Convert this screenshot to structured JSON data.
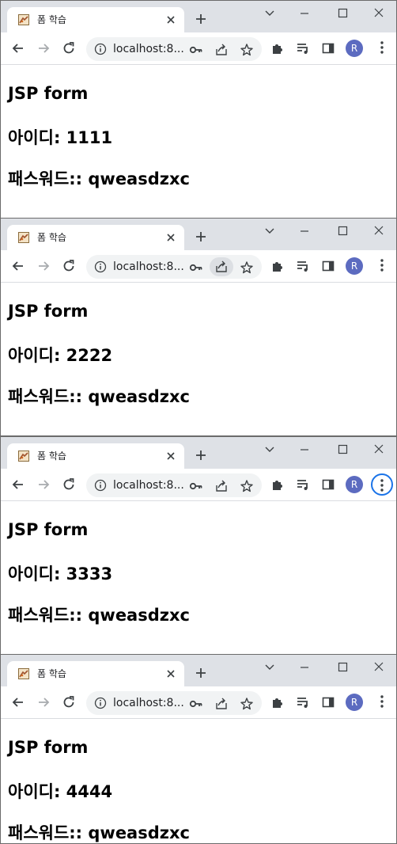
{
  "windows": [
    {
      "tab_title": "폼 학습",
      "url": "localhost:8...",
      "avatar_letter": "R",
      "heading": "JSP form",
      "id_line": "아이디: 1111",
      "pw_line": "패스워드:: qweasdzxc",
      "share_highlighted": false,
      "menu_focused": false
    },
    {
      "tab_title": "폼 학습",
      "url": "localhost:8...",
      "avatar_letter": "R",
      "heading": "JSP form",
      "id_line": "아이디: 2222",
      "pw_line": "패스워드:: qweasdzxc",
      "share_highlighted": true,
      "menu_focused": false
    },
    {
      "tab_title": "폼 학습",
      "url": "localhost:8...",
      "avatar_letter": "R",
      "heading": "JSP form",
      "id_line": "아이디: 3333",
      "pw_line": "패스워드:: qweasdzxc",
      "share_highlighted": false,
      "menu_focused": true
    },
    {
      "tab_title": "폼 학습",
      "url": "localhost:8...",
      "avatar_letter": "R",
      "heading": "JSP form",
      "id_line": "아이디: 4444",
      "pw_line": "패스워드:: qweasdzxc",
      "share_highlighted": false,
      "menu_focused": false
    }
  ],
  "icons": {
    "tab_favicon": "tomcat-favicon-icon",
    "close": "close-icon",
    "new_tab": "plus-icon",
    "minimize": "minimize-icon",
    "maximize": "maximize-icon",
    "window_close": "window-close-icon",
    "tab_search": "chevron-down-icon",
    "back": "back-arrow-icon",
    "forward": "forward-arrow-icon",
    "reload": "reload-icon",
    "site_info": "info-icon",
    "password_key": "key-icon",
    "share": "share-icon",
    "bookmark": "star-icon",
    "extensions": "puzzle-icon",
    "media": "media-queue-icon",
    "side_panel": "side-panel-icon",
    "menu": "kebab-menu-icon"
  },
  "colors": {
    "titlebar_bg": "#dee1e6",
    "omnibox_bg": "#f1f3f4",
    "avatar_bg": "#5c6bc0",
    "focus_ring": "#1a73e8"
  }
}
